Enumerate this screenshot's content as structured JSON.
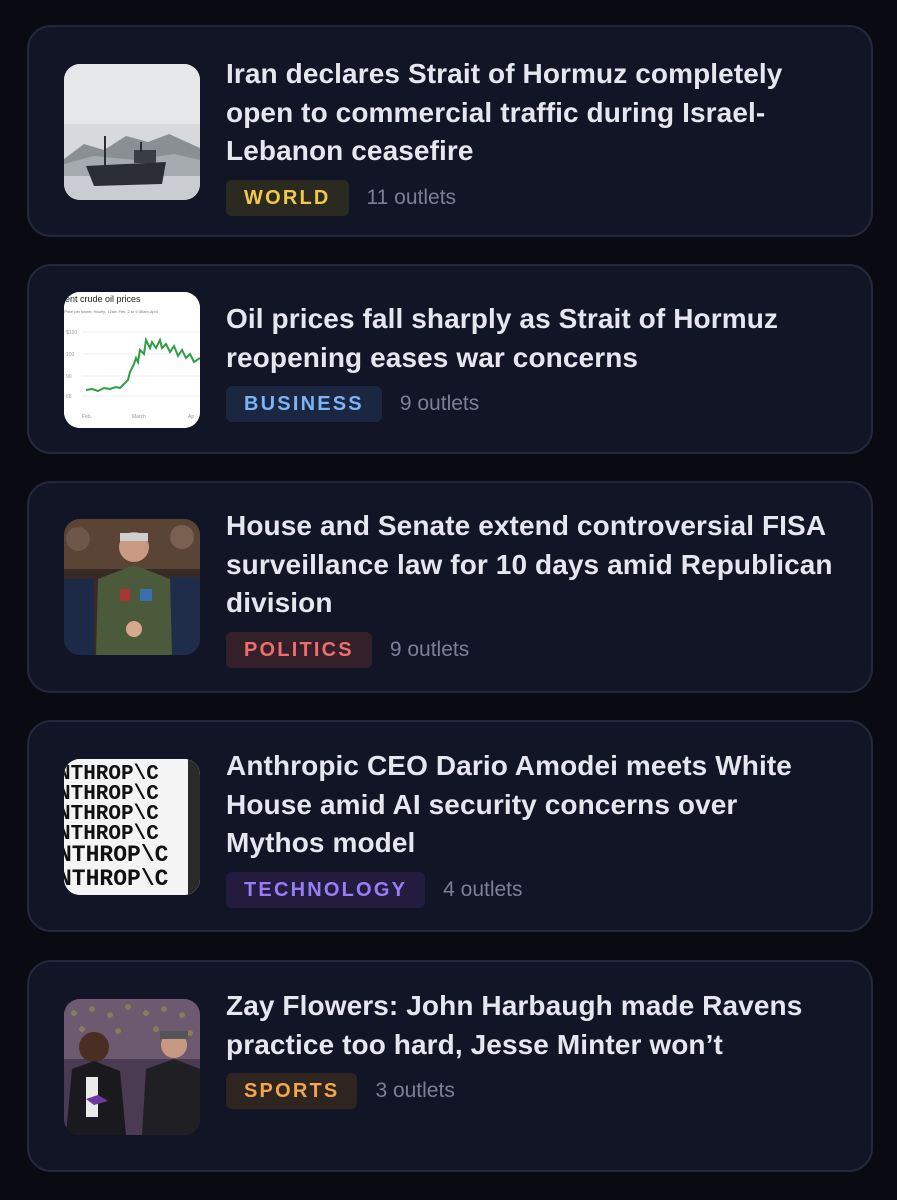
{
  "stories": [
    {
      "headline": "Iran declares Strait of Hormuz completely open to commercial traffic during Israel-Lebanon ceasefire",
      "category": "WORLD",
      "outlets": "11 outlets",
      "thumbnail": "cargo-ship-photo",
      "badge_colors": {
        "bg": "#2b2a20",
        "fg": "#f2c84b"
      }
    },
    {
      "headline": "Oil prices fall sharply as Strait of Hormuz reopening eases war concerns",
      "category": "BUSINESS",
      "outlets": "9 outlets",
      "thumbnail": "oil-price-chart",
      "thumbnail_text": {
        "title": "rent crude oil prices",
        "subtitle": "Price per barrel; Hourly; 12am Feb. 2 to 9:30am April",
        "y_ticks": [
          "$120",
          "100",
          "90",
          "68"
        ],
        "x_ticks": [
          "Feb.",
          "March",
          "Ap"
        ]
      },
      "badge_colors": {
        "bg": "#1b2640",
        "fg": "#7eb4f5"
      }
    },
    {
      "headline": "House and Senate extend controversial FISA surveillance law for 10 days amid Republican division",
      "category": "POLITICS",
      "outlets": "9 outlets",
      "thumbnail": "military-officer-photo",
      "badge_colors": {
        "bg": "#33202a",
        "fg": "#f06d6d"
      }
    },
    {
      "headline": "Anthropic CEO Dario Amodei meets White House amid AI security concerns over Mythos model",
      "category": "TECHNOLOGY",
      "outlets": "4 outlets",
      "thumbnail": "anthropic-logo-pattern",
      "thumbnail_text": {
        "word": "NTHROP\\C"
      },
      "badge_colors": {
        "bg": "#231c3f",
        "fg": "#9a7cf5"
      }
    },
    {
      "headline": "Zay Flowers: John Harbaugh made Ravens practice too hard, Jesse Minter won’t",
      "category": "SPORTS",
      "outlets": "3 outlets",
      "thumbnail": "football-players-photo",
      "badge_colors": {
        "bg": "#2e2420",
        "fg": "#f3a64e"
      }
    }
  ]
}
